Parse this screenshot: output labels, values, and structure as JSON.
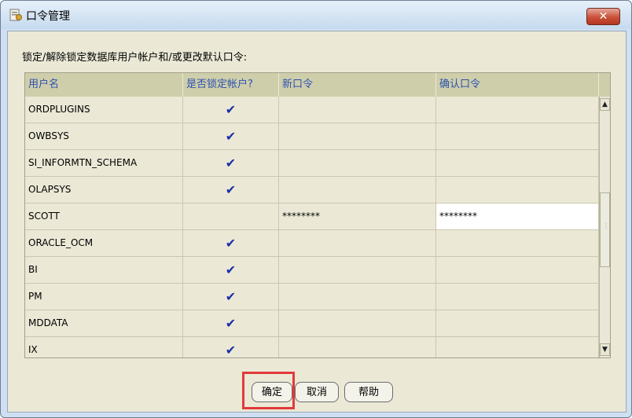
{
  "window": {
    "title": "口令管理",
    "close_glyph": "✕"
  },
  "instruction": "锁定/解除锁定数据库用户帐户和/或更改默认口令:",
  "table": {
    "columns": [
      "用户名",
      "是否锁定帐户?",
      "新口令",
      "确认口令"
    ],
    "rows": [
      {
        "user": "ORDPLUGINS",
        "locked": true,
        "new_password": "",
        "confirm_password": ""
      },
      {
        "user": "OWBSYS",
        "locked": true,
        "new_password": "",
        "confirm_password": ""
      },
      {
        "user": "SI_INFORMTN_SCHEMA",
        "locked": true,
        "new_password": "",
        "confirm_password": ""
      },
      {
        "user": "OLAPSYS",
        "locked": true,
        "new_password": "",
        "confirm_password": ""
      },
      {
        "user": "SCOTT",
        "locked": false,
        "new_password": "********",
        "confirm_password": "********"
      },
      {
        "user": "ORACLE_OCM",
        "locked": true,
        "new_password": "",
        "confirm_password": ""
      },
      {
        "user": "BI",
        "locked": true,
        "new_password": "",
        "confirm_password": ""
      },
      {
        "user": "PM",
        "locked": true,
        "new_password": "",
        "confirm_password": ""
      },
      {
        "user": "MDDATA",
        "locked": true,
        "new_password": "",
        "confirm_password": ""
      },
      {
        "user": "IX",
        "locked": true,
        "new_password": "",
        "confirm_password": ""
      }
    ],
    "check_glyph": "✔"
  },
  "scrollbar": {
    "up_glyph": "▲",
    "down_glyph": "▼"
  },
  "buttons": {
    "ok": "确定",
    "cancel": "取消",
    "help": "帮助"
  },
  "colors": {
    "highlight_frame": "#e23a3a",
    "checkmark": "#1a2fa8",
    "header_text": "#2c52b0"
  }
}
